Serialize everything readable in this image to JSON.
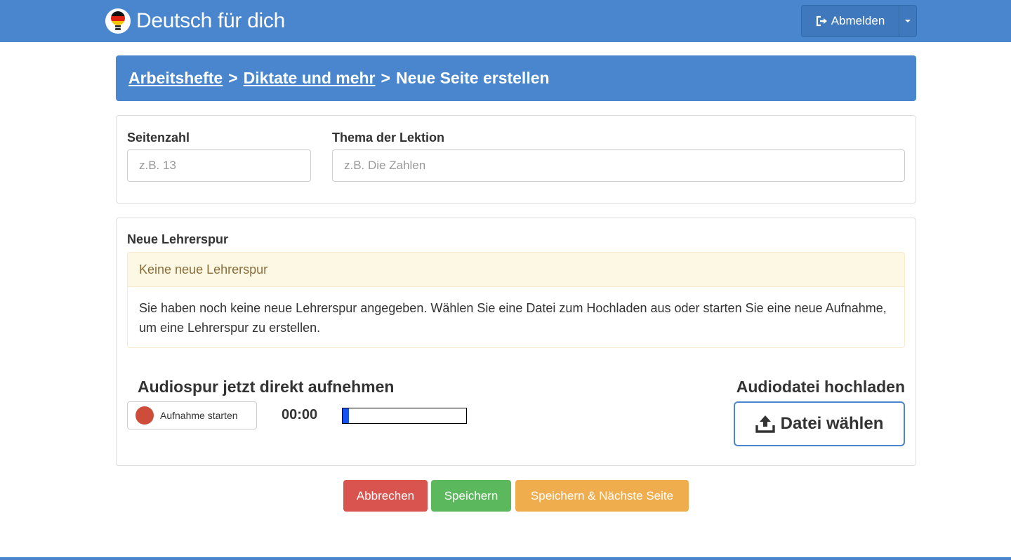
{
  "navbar": {
    "brand": "Deutsch für dich",
    "logout_label": "Abmelden"
  },
  "breadcrumb": {
    "items": [
      "Arbeitshefte",
      "Diktate und mehr",
      "Neue Seite erstellen"
    ],
    "separator": ">"
  },
  "page_form": {
    "page_number_label": "Seitenzahl",
    "page_number_placeholder": "z.B. 13",
    "topic_label": "Thema der Lektion",
    "topic_placeholder": "z.B. Die Zahlen"
  },
  "teacher_track": {
    "title": "Neue Lehrerspur",
    "alert_title": "Keine neue Lehrerspur",
    "alert_text": "Sie haben noch keine neue Lehrerspur angegeben. Wählen Sie eine Datei zum Hochladen aus oder starten Sie eine neue Aufnahme, um eine Lehrerspur zu erstellen."
  },
  "recording": {
    "title": "Audiospur jetzt direkt aufnehmen",
    "start_label": "Aufnahme starten",
    "timer": "00:00",
    "level": 0.05
  },
  "upload": {
    "title": "Audiodatei hochladen",
    "button_label": "Datei wählen"
  },
  "actions": {
    "cancel": "Abbrechen",
    "save": "Speichern",
    "save_next": "Speichern & Nächste Seite"
  },
  "colors": {
    "primary": "#4a86cd",
    "danger": "#d9534f",
    "success": "#5cb85c",
    "warning": "#f0ad4e",
    "record": "#cd4d3a",
    "level_fill": "#1652f0"
  },
  "icons": {
    "brand": "germany-bulb-logo-icon",
    "logout": "sign-out-icon",
    "dropdown": "caret-down-icon",
    "record": "record-dot-icon",
    "upload": "upload-icon"
  }
}
